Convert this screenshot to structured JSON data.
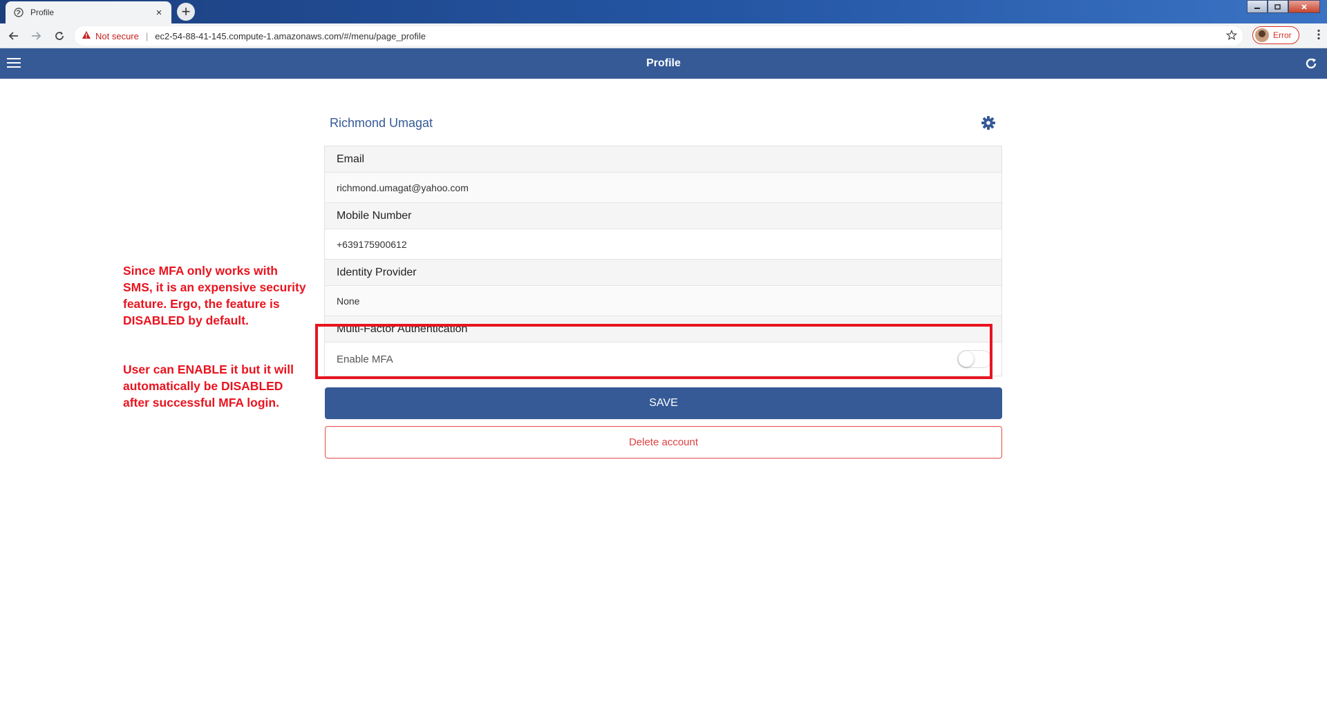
{
  "browser": {
    "tab_title": "Profile",
    "tab_close": "×",
    "new_tab": "+",
    "security_warning": "Not secure",
    "separator": "|",
    "url": "ec2-54-88-41-145.compute-1.amazonaws.com/#/menu/page_profile",
    "profile_status": "Error"
  },
  "app": {
    "header_title": "Profile"
  },
  "profile": {
    "name": "Richmond Umagat",
    "email_label": "Email",
    "email_value": "richmond.umagat@yahoo.com",
    "mobile_label": "Mobile Number",
    "mobile_value": "+639175900612",
    "idp_label": "Identity Provider",
    "idp_value": "None",
    "mfa_label": "Multi-Factor Authentication",
    "mfa_toggle_label": "Enable MFA",
    "mfa_enabled": false,
    "save_label": "SAVE",
    "delete_label": "Delete account"
  },
  "annotation": {
    "note_1": "Since MFA only works with SMS, it is an expensive security feature. Ergo, the feature is DISABLED by default.",
    "note_2": "User can ENABLE it but it will automatically be DISABLED after successful MFA login.",
    "color": "#e8141f"
  },
  "colors": {
    "brand": "#355a96",
    "danger": "#e04040"
  }
}
